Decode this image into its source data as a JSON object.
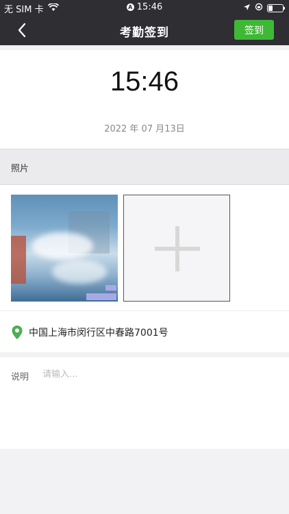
{
  "status_bar": {
    "carrier": "无 SIM 卡",
    "time": "15:46"
  },
  "nav": {
    "title": "考勤签到",
    "signin_label": "签到"
  },
  "clock": {
    "time": "15:46",
    "date": "2022 年 07 月13日"
  },
  "photo": {
    "header": "照片"
  },
  "location": {
    "address": "中国上海市闵行区中春路7001号",
    "icon": "map-pin-icon",
    "icon_color": "#4caf50"
  },
  "note": {
    "label": "说明",
    "placeholder": "请输入..."
  },
  "colors": {
    "nav_bg": "#2e2e33",
    "accent": "#3fb836"
  }
}
